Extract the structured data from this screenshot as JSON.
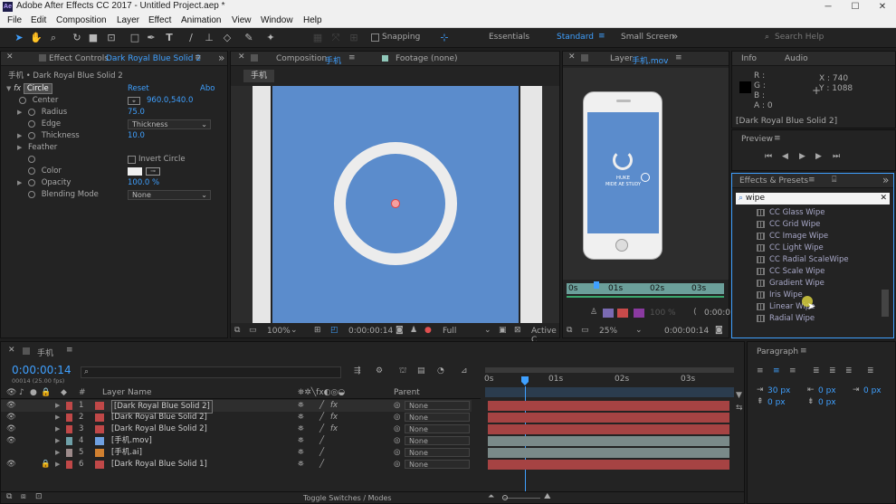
{
  "window": {
    "title": "Adobe After Effects CC 2017 - Untitled Project.aep *",
    "logo": "Ae"
  },
  "menu": [
    "File",
    "Edit",
    "Composition",
    "Layer",
    "Effect",
    "Animation",
    "View",
    "Window",
    "Help"
  ],
  "toolbar": {
    "snapping": "Snapping",
    "workspaces": [
      "Essentials",
      "Standard",
      "Small Screen"
    ],
    "active_workspace": "Standard",
    "search_help": "Search Help"
  },
  "effect_controls": {
    "tab_label": "Effect Controls",
    "tab_layer": "Dark Royal Blue Solid 2",
    "breadcrumb": "手机 • Dark Royal Blue Solid 2",
    "effect_name": "Circle",
    "reset": "Reset",
    "about": "Abo",
    "props": [
      {
        "name": "Center",
        "value": "960.0,540.0"
      },
      {
        "name": "Radius",
        "value": "75.0"
      },
      {
        "name": "Edge",
        "value": "Thickness"
      },
      {
        "name": "Thickness",
        "value": "10.0"
      },
      {
        "name": "Feather",
        "value": ""
      },
      {
        "name": "",
        "value": "Invert Circle"
      },
      {
        "name": "Color",
        "value": ""
      },
      {
        "name": "Opacity",
        "value": "100.0 %"
      },
      {
        "name": "Blending Mode",
        "value": "None"
      }
    ],
    "fx_icon": "fx"
  },
  "composition": {
    "tab_label": "Composition",
    "tab_name": "手机",
    "footage_label": "Footage (none)",
    "subtab": "手机",
    "zoom": "100%",
    "time": "0:00:00:14",
    "quality": "Full",
    "active_camera": "Active C"
  },
  "layer_panel": {
    "tab_label": "Layer",
    "tab_name": "手机.mov",
    "phone_text1": "HUKE",
    "phone_text2": "MIDE AE STUDY",
    "ruler": [
      "0s",
      "01s",
      "02s",
      "03s"
    ],
    "opacity": "100 %",
    "zoom": "25%",
    "time": "0:00:00:14",
    "time2": "0:00:0"
  },
  "info": {
    "tab": "Info",
    "tab2": "Audio",
    "r": "R :",
    "g": "G :",
    "b": "B :",
    "a": "A : 0",
    "x": "X : 740",
    "y": "Y : 1088",
    "layer": "[Dark Royal Blue Solid 2]"
  },
  "preview": {
    "tab": "Preview"
  },
  "effects_presets": {
    "tab": "Effects & Presets",
    "search": "wipe",
    "items": [
      "CC Glass Wipe",
      "CC Grid Wipe",
      "CC Image Wipe",
      "CC Light Wipe",
      "CC Radial ScaleWipe",
      "CC Scale Wipe",
      "Gradient Wipe",
      "Iris Wipe",
      "Linear Wipe",
      "Radial Wipe"
    ]
  },
  "paragraph": {
    "tab": "Paragraph",
    "indent1": "30 px",
    "indent2": "0 px",
    "indent3": "0 px",
    "space1": "0 px",
    "space2": "0 px"
  },
  "timeline": {
    "tab": "手机",
    "timecode": "0:00:00:14",
    "frames": "00014 (25.00 fps)",
    "col_num": "#",
    "col_name": "Layer Name",
    "col_parent": "Parent",
    "ruler": [
      "0s",
      "01s",
      "02s",
      "03s"
    ],
    "layers": [
      {
        "n": "1",
        "name": "[Dark Royal Blue Solid 2]",
        "fx": "fx",
        "parent": "None",
        "color": "#c04848"
      },
      {
        "n": "2",
        "name": "[Dark Royal Blue Solid 2]",
        "fx": "fx",
        "parent": "None",
        "color": "#c04848"
      },
      {
        "n": "3",
        "name": "[Dark Royal Blue Solid 2]",
        "fx": "fx",
        "parent": "None",
        "color": "#c04848"
      },
      {
        "n": "4",
        "name": "[手机.mov]",
        "fx": "",
        "parent": "None",
        "color": "#6fa0a8"
      },
      {
        "n": "5",
        "name": "[手机.ai]",
        "fx": "",
        "parent": "None",
        "color": "#9c8a8a"
      },
      {
        "n": "6",
        "name": "[Dark Royal Blue Solid 1]",
        "fx": "",
        "parent": "None",
        "color": "#c04848"
      }
    ],
    "toggle": "Toggle Switches / Modes"
  },
  "colors": {
    "comp_blue": "#5b8ccc",
    "accent": "#3fa0ff",
    "layer_red": "#a64343"
  }
}
